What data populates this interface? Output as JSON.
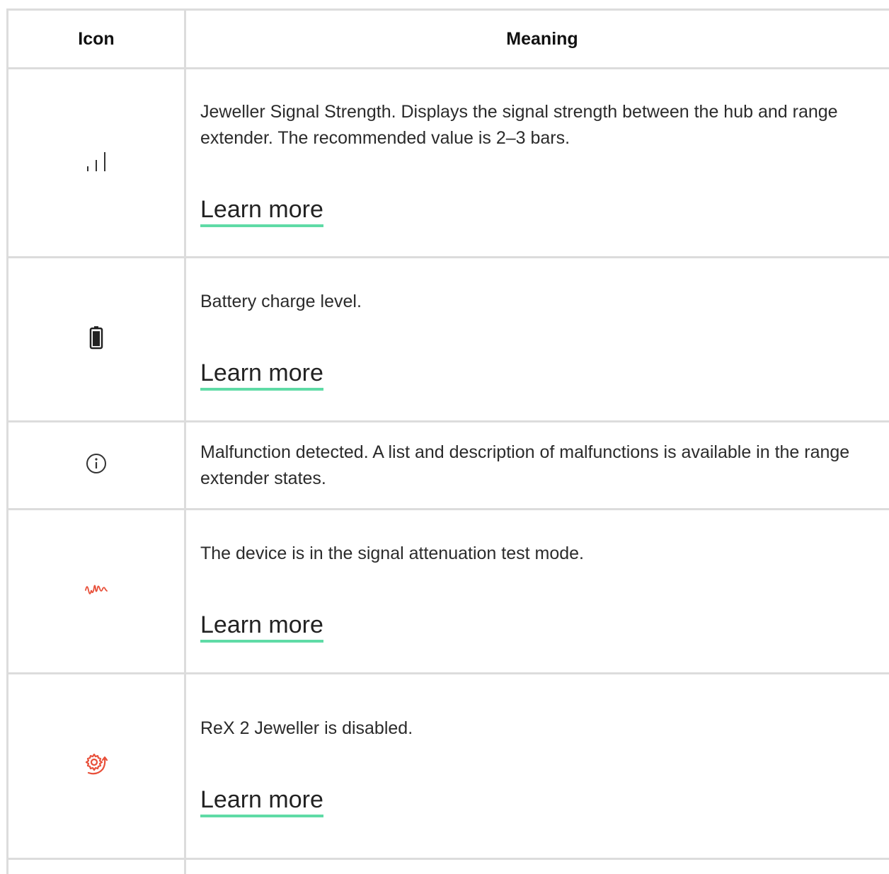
{
  "table": {
    "header": {
      "icon": "Icon",
      "meaning": "Meaning"
    },
    "rows": [
      {
        "icon": "signal-strength-icon",
        "description": "Jeweller Signal Strength. Displays the signal strength between the hub and range extender. The recommended value is 2–3 bars.",
        "link": "Learn more"
      },
      {
        "icon": "battery-icon",
        "description": "Battery charge level.",
        "link": "Learn more"
      },
      {
        "icon": "info-icon",
        "description": "Malfunction detected. A list and description of malfunctions is available in the range extender states."
      },
      {
        "icon": "signal-attenuation-icon",
        "icon_color": "#e8503a",
        "description": "The device is in the signal attenuation test mode.",
        "link": "Learn more"
      },
      {
        "icon": "device-disabled-gear-icon",
        "icon_color": "#e8503a",
        "description": "ReX 2 Jeweller is disabled.",
        "link": "Learn more"
      }
    ]
  },
  "colors": {
    "border": "#dcdcdc",
    "link_underline": "#5fdba6",
    "accent_red": "#e8503a"
  }
}
